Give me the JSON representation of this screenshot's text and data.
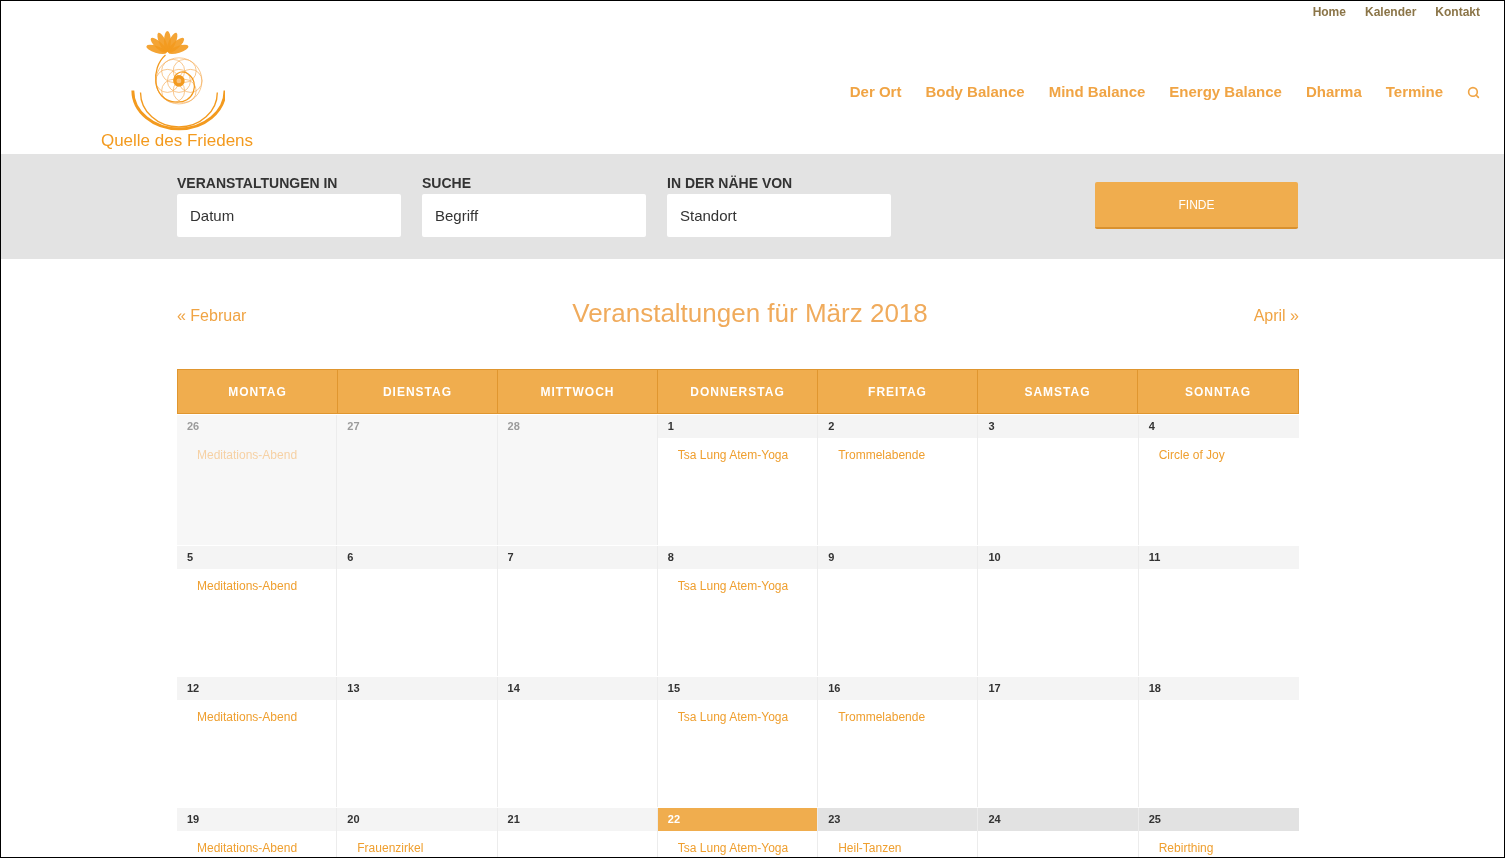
{
  "top_links": [
    "Home",
    "Kalender",
    "Kontakt"
  ],
  "logo": {
    "text": "Quelle des Friedens"
  },
  "nav": {
    "items": [
      "Der Ort",
      "Body Balance",
      "Mind Balance",
      "Energy Balance",
      "Dharma",
      "Termine"
    ]
  },
  "search_bar": {
    "fields": [
      {
        "label": "VERANSTALTUNGEN IN",
        "placeholder": "Datum"
      },
      {
        "label": "SUCHE",
        "placeholder": "Begriff"
      },
      {
        "label": "IN DER NÄHE VON",
        "placeholder": "Standort"
      }
    ],
    "button": "FINDE"
  },
  "calendar": {
    "prev": "« Februar",
    "title": "Veranstaltungen für März 2018",
    "next": "April »",
    "weekdays": [
      "MONTAG",
      "DIENSTAG",
      "MITTWOCH",
      "DONNERSTAG",
      "FREITAG",
      "SAMSTAG",
      "SONNTAG"
    ],
    "weeks": [
      [
        {
          "day": "26",
          "kind": "other-month",
          "events": [
            "Meditations-Abend"
          ]
        },
        {
          "day": "27",
          "kind": "other-month"
        },
        {
          "day": "28",
          "kind": "other-month"
        },
        {
          "day": "1",
          "kind": "past",
          "events": [
            "Tsa Lung Atem-Yoga"
          ]
        },
        {
          "day": "2",
          "kind": "past",
          "events": [
            "Trommelabende"
          ]
        },
        {
          "day": "3",
          "kind": "past"
        },
        {
          "day": "4",
          "kind": "past",
          "events": [
            "Circle of Joy"
          ]
        }
      ],
      [
        {
          "day": "5",
          "kind": "past",
          "events": [
            "Meditations-Abend"
          ]
        },
        {
          "day": "6",
          "kind": "past"
        },
        {
          "day": "7",
          "kind": "past"
        },
        {
          "day": "8",
          "kind": "past",
          "events": [
            "Tsa Lung Atem-Yoga"
          ]
        },
        {
          "day": "9",
          "kind": "past"
        },
        {
          "day": "10",
          "kind": "past"
        },
        {
          "day": "11",
          "kind": "past"
        }
      ],
      [
        {
          "day": "12",
          "kind": "past",
          "events": [
            "Meditations-Abend"
          ]
        },
        {
          "day": "13",
          "kind": "past"
        },
        {
          "day": "14",
          "kind": "past"
        },
        {
          "day": "15",
          "kind": "past",
          "events": [
            "Tsa Lung Atem-Yoga"
          ]
        },
        {
          "day": "16",
          "kind": "past",
          "events": [
            "Trommelabende"
          ]
        },
        {
          "day": "17",
          "kind": "past"
        },
        {
          "day": "18",
          "kind": "past"
        }
      ],
      [
        {
          "day": "19",
          "kind": "past",
          "events": [
            "Meditations-Abend"
          ]
        },
        {
          "day": "20",
          "kind": "past",
          "events": [
            "Frauenzirkel"
          ]
        },
        {
          "day": "21",
          "kind": "past"
        },
        {
          "day": "22",
          "kind": "today",
          "events": [
            "Tsa Lung Atem-Yoga"
          ]
        },
        {
          "day": "23",
          "kind": "future",
          "events": [
            "Heil-Tanzen"
          ]
        },
        {
          "day": "24",
          "kind": "future"
        },
        {
          "day": "25",
          "kind": "future",
          "events": [
            "Rebirthing"
          ]
        }
      ]
    ]
  }
}
